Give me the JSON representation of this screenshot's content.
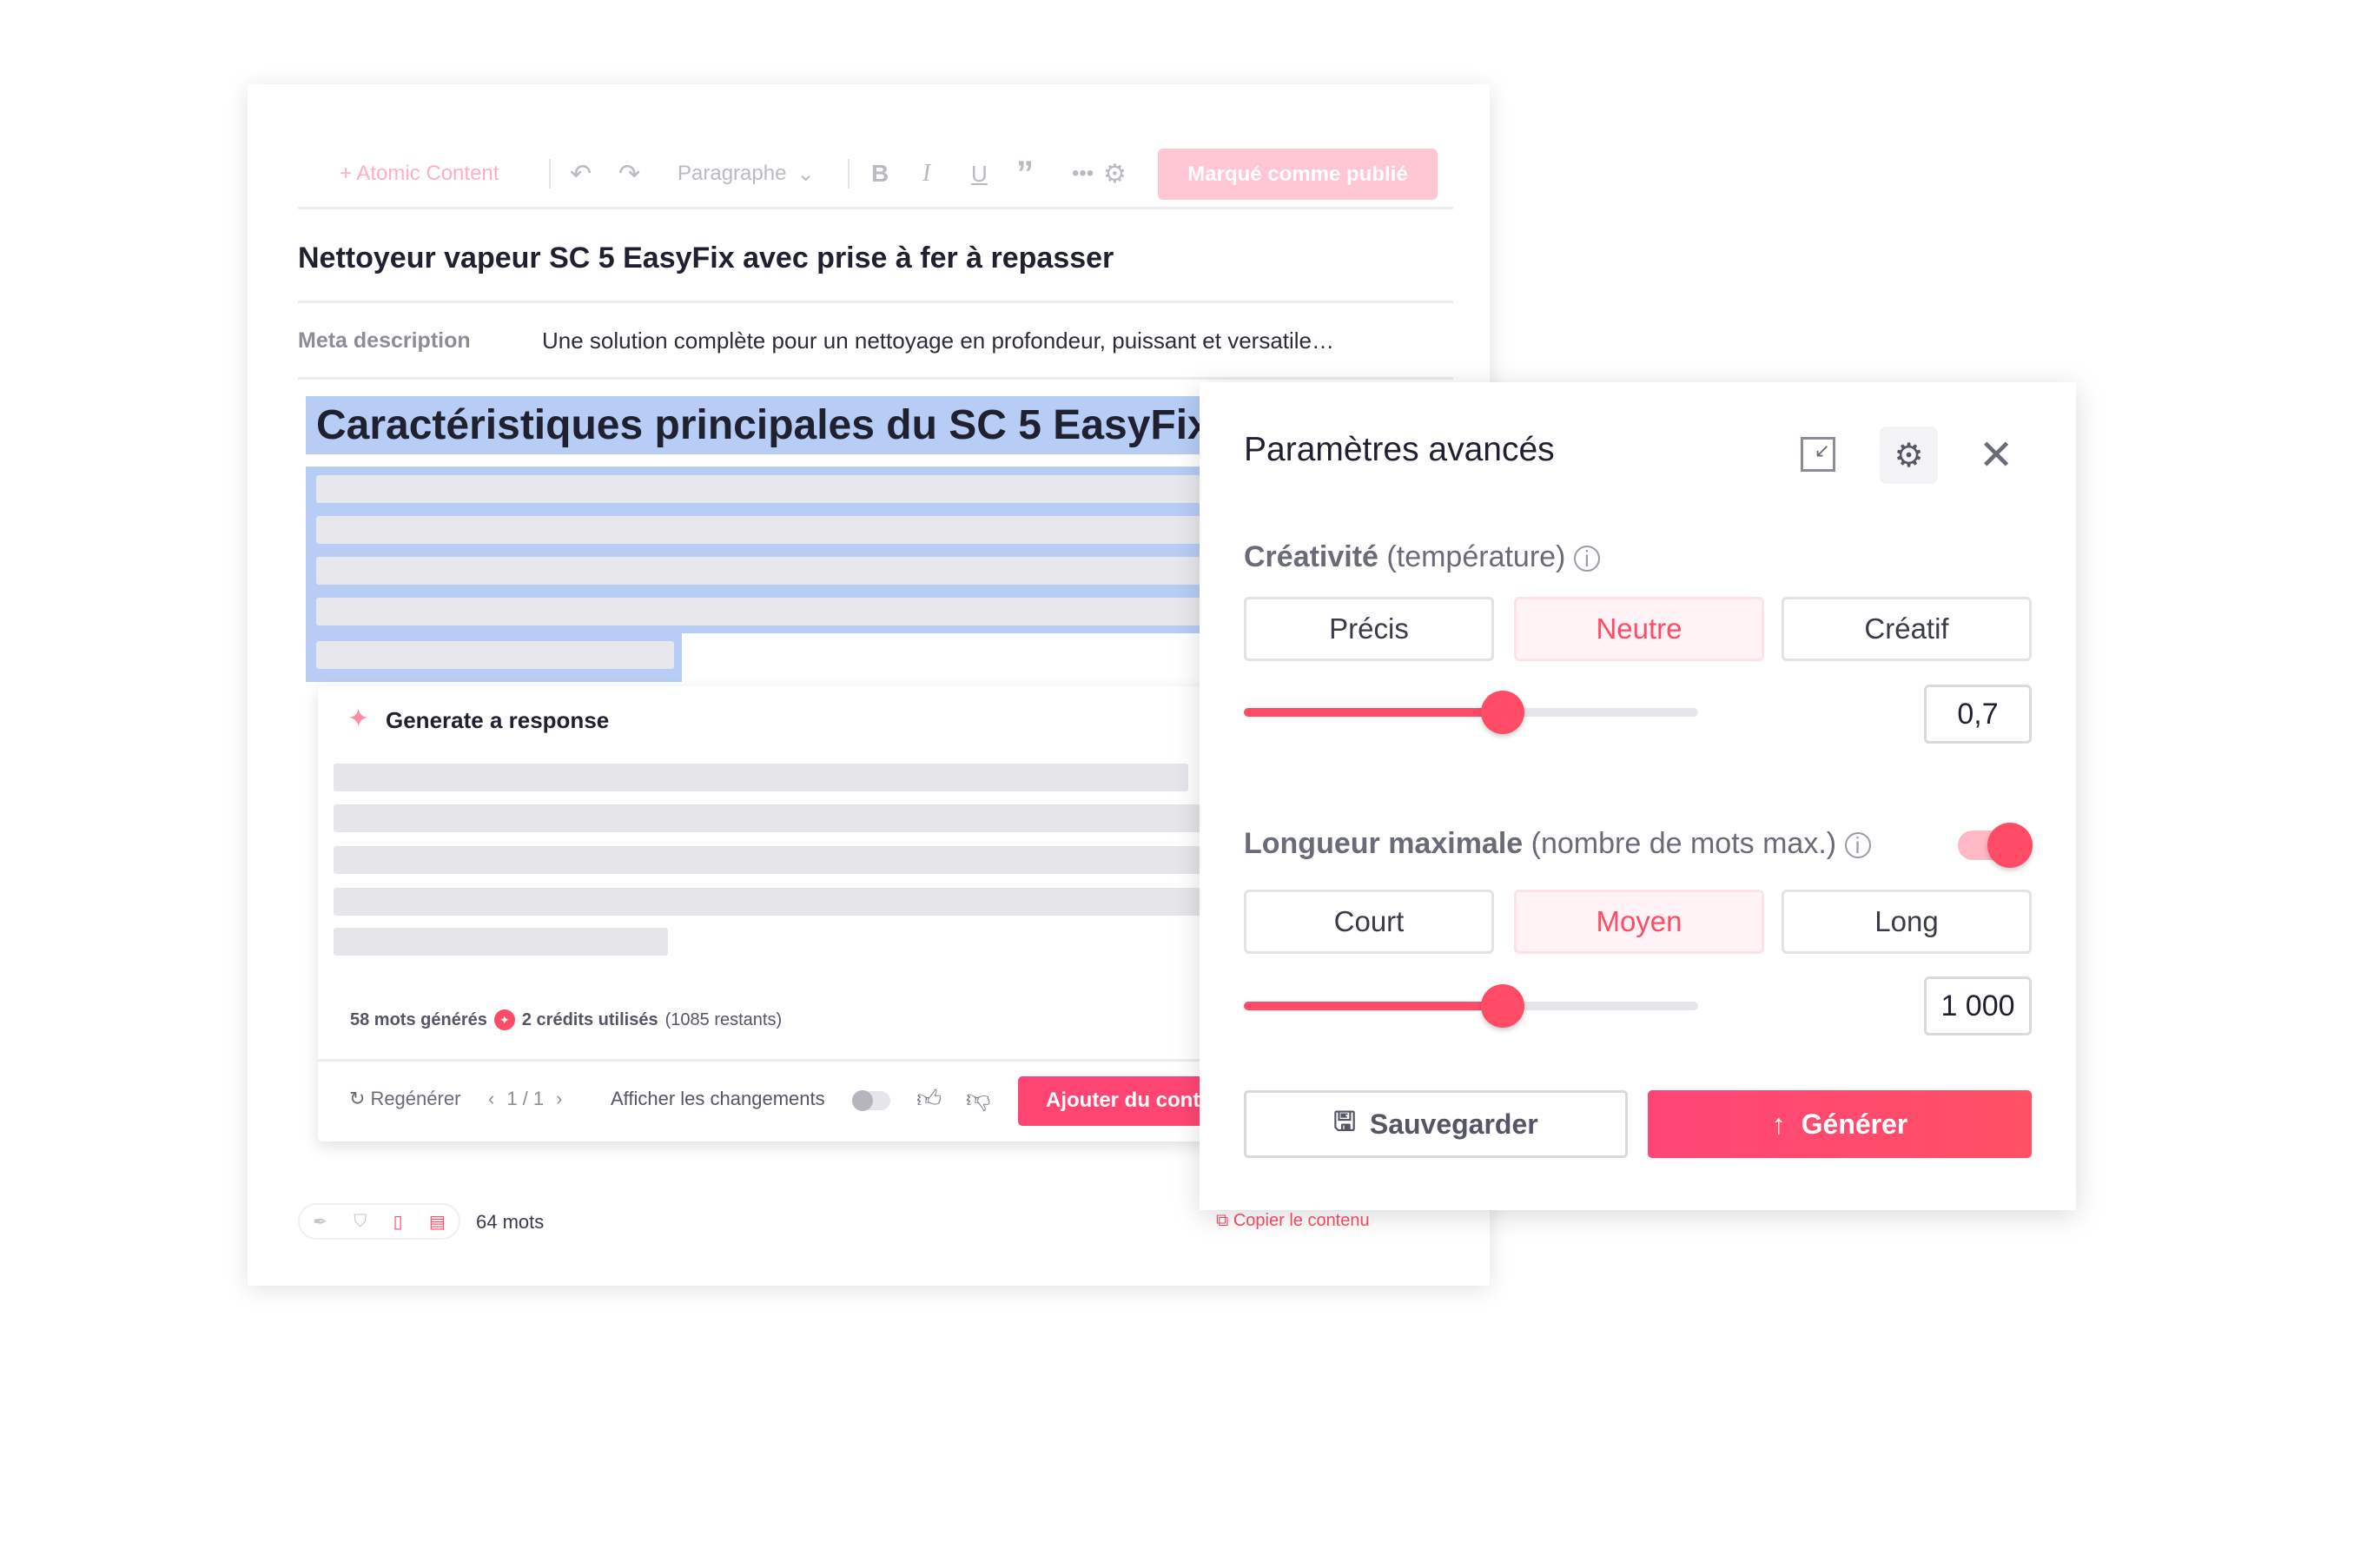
{
  "editor": {
    "toolbar": {
      "atomic": "+ Atomic Content",
      "paragraph": "Paragraphe",
      "publish": "Marqué comme publié"
    },
    "title": "Nettoyeur vapeur SC 5 EasyFix avec prise à fer à repasser",
    "meta_label": "Meta description",
    "meta_value": "Une solution complète pour un nettoyage en profondeur, puissant et versatile…",
    "heading": "Caractéristiques principales du SC 5 EasyFix",
    "generate": {
      "title": "Generate a response",
      "words_generated": "58 mots générés",
      "credits_used": "2 crédits utilisés",
      "credits_remaining": "(1085 restants)",
      "regenerate": "Regénérer",
      "pager": "1 / 1",
      "show_changes": "Afficher les changements",
      "show_changes_on": false,
      "add_button": "Ajouter du contenu"
    },
    "word_count": "64 mots",
    "copy": "Copier le contenu"
  },
  "settings": {
    "title": "Paramètres avancés",
    "creativity": {
      "label": "Créativité",
      "sub": "(température)",
      "options": [
        "Précis",
        "Neutre",
        "Créatif"
      ],
      "selected": "Neutre",
      "value": "0,7",
      "slider_fraction": 0.57
    },
    "length": {
      "label": "Longueur maximale",
      "sub": "(nombre de mots max.)",
      "enabled": true,
      "options": [
        "Court",
        "Moyen",
        "Long"
      ],
      "selected": "Moyen",
      "value": "1 000",
      "slider_fraction": 0.57
    },
    "save": "Sauvegarder",
    "generate": "Générer"
  },
  "colors": {
    "accent": "#ff4b66",
    "selection": "#b7cdf5"
  }
}
